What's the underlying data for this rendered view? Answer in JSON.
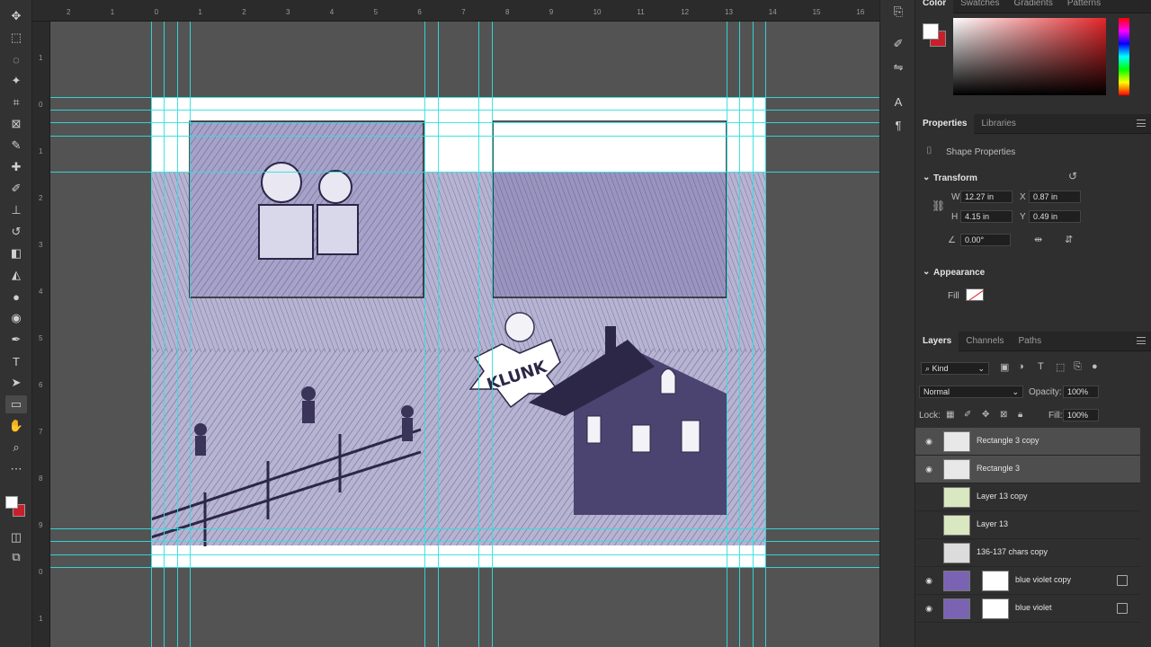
{
  "toolbar": {
    "tools": [
      {
        "id": "move",
        "icon": "move-icon",
        "glyph": "✥"
      },
      {
        "id": "marquee",
        "icon": "marquee-icon",
        "glyph": "⬚"
      },
      {
        "id": "lasso",
        "icon": "lasso-icon",
        "glyph": "◌"
      },
      {
        "id": "magic-wand",
        "icon": "magic-wand-icon",
        "glyph": "✦"
      },
      {
        "id": "crop",
        "icon": "crop-icon",
        "glyph": "⌗"
      },
      {
        "id": "frame",
        "icon": "frame-icon",
        "glyph": "⊠"
      },
      {
        "id": "eyedropper",
        "icon": "eyedropper-icon",
        "glyph": "✎"
      },
      {
        "id": "healing",
        "icon": "healing-icon",
        "glyph": "✚"
      },
      {
        "id": "brush",
        "icon": "brush-icon",
        "glyph": "✐"
      },
      {
        "id": "stamp",
        "icon": "stamp-icon",
        "glyph": "⊥"
      },
      {
        "id": "history-brush",
        "icon": "history-brush-icon",
        "glyph": "↺"
      },
      {
        "id": "eraser",
        "icon": "eraser-icon",
        "glyph": "◧"
      },
      {
        "id": "paint-bucket",
        "icon": "paint-bucket-icon",
        "glyph": "◭"
      },
      {
        "id": "blur",
        "icon": "blur-icon",
        "glyph": "●"
      },
      {
        "id": "dodge",
        "icon": "dodge-icon",
        "glyph": "◉"
      },
      {
        "id": "pen",
        "icon": "pen-icon",
        "glyph": "✒"
      },
      {
        "id": "type",
        "icon": "type-icon",
        "glyph": "T"
      },
      {
        "id": "path-select",
        "icon": "path-select-icon",
        "glyph": "➤"
      },
      {
        "id": "rectangle",
        "icon": "rectangle-icon",
        "glyph": "▭"
      },
      {
        "id": "hand",
        "icon": "hand-icon",
        "glyph": "✋"
      },
      {
        "id": "zoom",
        "icon": "zoom-icon",
        "glyph": "⌕"
      },
      {
        "id": "more",
        "icon": "more-icon",
        "glyph": "⋯"
      }
    ]
  },
  "ruler": {
    "top": [
      "2",
      "1",
      "0",
      "1",
      "2",
      "3",
      "4",
      "5",
      "6",
      "7",
      "8",
      "9",
      "10",
      "11",
      "12",
      "13",
      "14",
      "15",
      "16"
    ],
    "left": [
      "1",
      "0",
      "1",
      "2",
      "3",
      "4",
      "5",
      "6",
      "7",
      "8",
      "9",
      "0",
      "1"
    ]
  },
  "color_panel": {
    "tabs": [
      "Color",
      "Swatches",
      "Gradients",
      "Patterns"
    ],
    "foreground": "#ffffff",
    "background": "#c8202a"
  },
  "properties": {
    "tabs": [
      "Properties",
      "Libraries"
    ],
    "shape_label": "Shape Properties",
    "transform_label": "Transform",
    "w_label": "W",
    "w_value": "12.27 in",
    "h_label": "H",
    "h_value": "4.15 in",
    "x_label": "X",
    "x_value": "0.87 in",
    "y_label": "Y",
    "y_value": "0.49 in",
    "angle_value": "0.00°",
    "appearance_label": "Appearance",
    "fill_label": "Fill"
  },
  "layers": {
    "tabs": [
      "Layers",
      "Channels",
      "Paths"
    ],
    "filter_kind": "Kind",
    "blend_mode": "Normal",
    "opacity_label": "Opacity:",
    "opacity_value": "100%",
    "lock_label": "Lock:",
    "fill_label": "Fill:",
    "fill_value": "100%",
    "items": [
      {
        "name": "Rectangle 3 copy",
        "visible": true,
        "selected": true,
        "thumb": "shape"
      },
      {
        "name": "Rectangle 3",
        "visible": true,
        "selected": true,
        "thumb": "shape"
      },
      {
        "name": "Layer 13 copy",
        "visible": false,
        "selected": false,
        "thumb": "green"
      },
      {
        "name": "Layer 13",
        "visible": false,
        "selected": false,
        "thumb": "green"
      },
      {
        "name": "136-137 chars copy",
        "visible": false,
        "selected": false,
        "thumb": "art"
      },
      {
        "name": "blue violet copy",
        "visible": true,
        "selected": false,
        "thumb": "violet"
      },
      {
        "name": "blue violet",
        "visible": true,
        "selected": false,
        "thumb": "violet"
      }
    ]
  },
  "colors": {
    "guide": "#2fe0e0",
    "art_ink": "#3a3458",
    "art_tint": "#8c86b8"
  }
}
